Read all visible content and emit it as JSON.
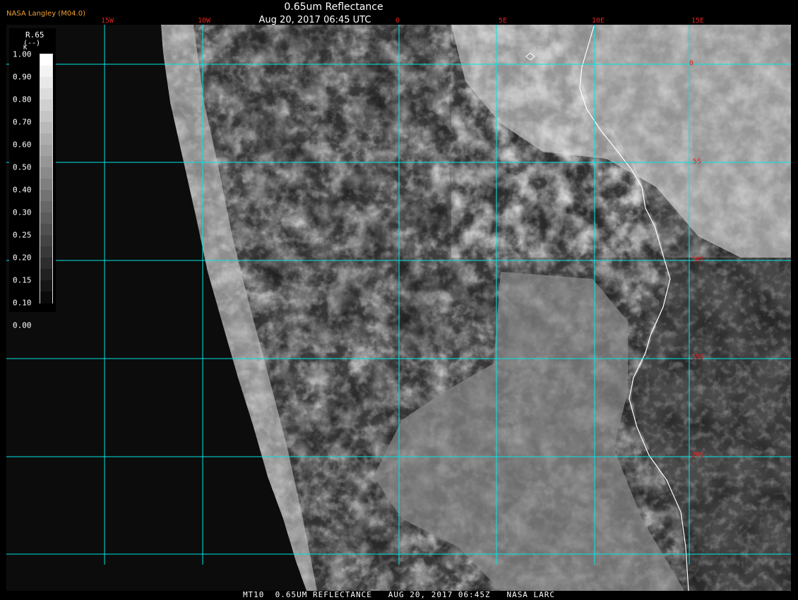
{
  "header": {
    "title": "0.65um Reflectance",
    "datetime": "Aug 20, 2017 06:45 UTC",
    "provider": "NASA Langley (M04.0)"
  },
  "grid": {
    "longitudes": [
      "15W",
      "10W",
      "0",
      "5E",
      "10E",
      "15E"
    ],
    "latitudes": [
      "0",
      "5S",
      "10S",
      "15S",
      "20S"
    ],
    "line_color": "#00e5e5",
    "label_color": "#e02020"
  },
  "colorbar": {
    "variable": "R.65",
    "units": "(--)",
    "k_label": "K",
    "ticks": [
      "1.00",
      "0.90",
      "0.80",
      "0.70",
      "0.60",
      "0.50",
      "0.40",
      "0.30",
      "0.25",
      "0.20",
      "0.15",
      "0.10",
      "0.00"
    ]
  },
  "footer": {
    "text": "MT10  0.65UM REFLECTANCE   AUG 20, 2017 06:45Z   NASA LARC"
  }
}
